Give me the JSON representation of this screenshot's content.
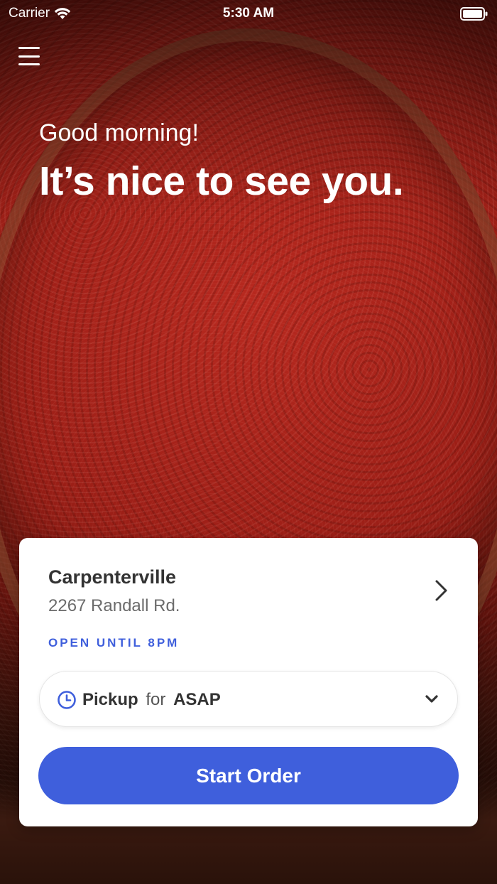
{
  "status_bar": {
    "carrier": "Carrier",
    "time": "5:30 AM"
  },
  "icons": {
    "menu": "hamburger-menu-icon",
    "wifi": "wifi-icon",
    "battery": "battery-icon",
    "location_chevron": "chevron-right-icon",
    "clock": "clock-icon",
    "dropdown": "chevron-down-icon"
  },
  "hero": {
    "greeting": "Good morning!",
    "headline": "It’s nice to see you."
  },
  "location": {
    "name": "Carpenterville",
    "address": "2267 Randall Rd.",
    "status": "OPEN UNTIL 8PM"
  },
  "order_type": {
    "mode": "Pickup",
    "connector": "for",
    "time": "ASAP"
  },
  "actions": {
    "start_order": "Start Order"
  },
  "colors": {
    "accent": "#3f5fdc",
    "card_background": "#ffffff",
    "title_text": "#333333",
    "secondary_text": "#6b6b6b"
  }
}
